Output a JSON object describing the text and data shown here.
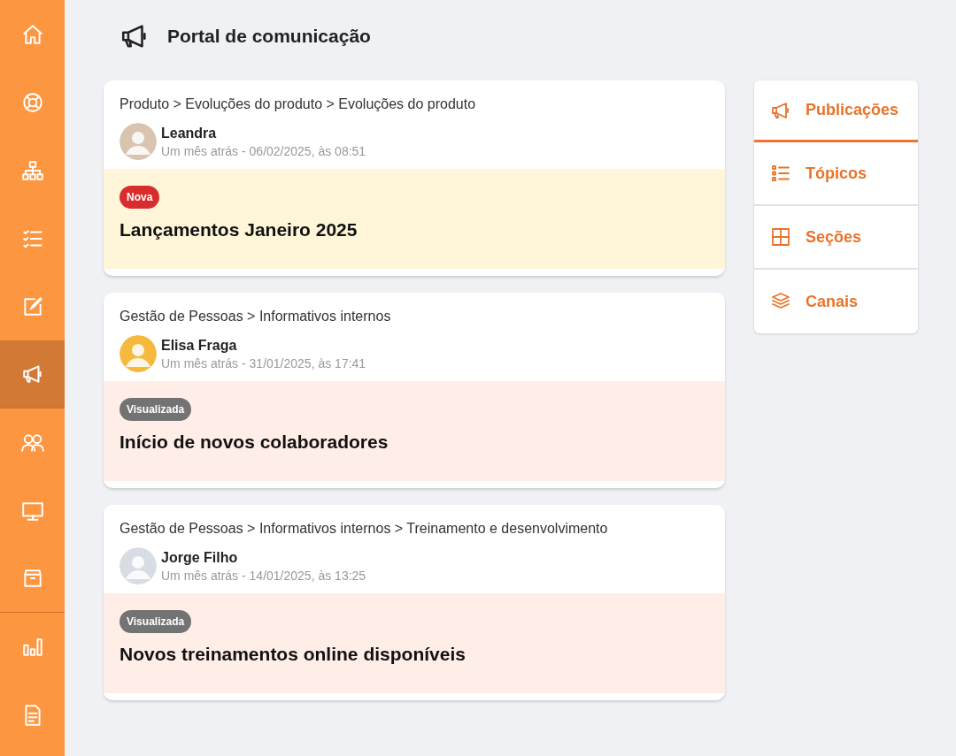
{
  "sidebar": {
    "items": [
      {
        "selected": false
      },
      {
        "selected": false
      },
      {
        "selected": false
      },
      {
        "selected": false
      },
      {
        "selected": false
      },
      {
        "selected": true
      },
      {
        "selected": false
      },
      {
        "selected": false
      },
      {
        "selected": false
      },
      {
        "selected": false
      },
      {
        "selected": false
      }
    ]
  },
  "header": {
    "title": "Portal de comunicação"
  },
  "posts": [
    {
      "breadcrumb": "Produto > Evoluções do produto > Evoluções do produto",
      "author": "Leandra",
      "meta": "Um mês atrás - 06/02/2025, às 08:51",
      "kind": "new",
      "badge": "Nova",
      "title": "Lançamentos Janeiro 2025"
    },
    {
      "breadcrumb": "Gestão de Pessoas > Informativos internos",
      "author": "Elisa Fraga",
      "meta": "Um mês atrás - 31/01/2025, às 17:41",
      "kind": "viewed",
      "badge": "Visualizada",
      "title": "Início de novos colaboradores"
    },
    {
      "breadcrumb": "Gestão de Pessoas > Informativos internos > Treinamento e desenvolvimento",
      "author": "Jorge Filho",
      "meta": "Um mês atrás - 14/01/2025, às 13:25",
      "kind": "viewed",
      "badge": "Visualizada",
      "title": "Novos treinamentos online disponíveis"
    }
  ],
  "tabs": [
    {
      "label": "Publicações",
      "selected": true
    },
    {
      "label": "Tópicos",
      "selected": false
    },
    {
      "label": "Seções",
      "selected": false
    },
    {
      "label": "Canais",
      "selected": false
    }
  ]
}
